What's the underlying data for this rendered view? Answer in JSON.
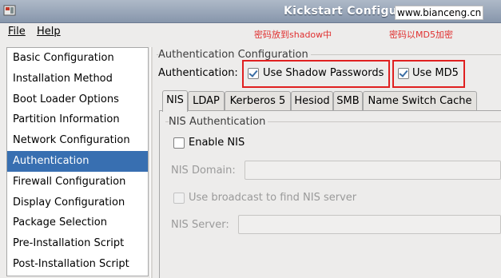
{
  "window": {
    "title": "Kickstart Configurator"
  },
  "watermark": "www.bianceng.cn",
  "menu": {
    "file_label": "File",
    "help_label": "Help"
  },
  "annotations": {
    "shadow_note": "密码放到shadow中",
    "md5_note": "密码以MD5加密"
  },
  "sidebar": {
    "items": [
      {
        "label": "Basic Configuration"
      },
      {
        "label": "Installation Method"
      },
      {
        "label": "Boot Loader Options"
      },
      {
        "label": "Partition Information"
      },
      {
        "label": "Network Configuration"
      },
      {
        "label": "Authentication"
      },
      {
        "label": "Firewall Configuration"
      },
      {
        "label": "Display Configuration"
      },
      {
        "label": "Package Selection"
      },
      {
        "label": "Pre-Installation Script"
      },
      {
        "label": "Post-Installation Script"
      }
    ],
    "selected": "Authentication"
  },
  "auth": {
    "group_title": "Authentication Configuration",
    "label": "Authentication:",
    "shadow": {
      "label": "Use Shadow Passwords",
      "checked": true
    },
    "md5": {
      "label": "Use MD5",
      "checked": true
    }
  },
  "tabs": [
    {
      "label": "NIS",
      "active": true
    },
    {
      "label": "LDAP"
    },
    {
      "label": "Kerberos 5"
    },
    {
      "label": "Hesiod"
    },
    {
      "label": "SMB"
    },
    {
      "label": "Name Switch Cache"
    }
  ],
  "nis": {
    "group_title": "NIS Authentication",
    "enable": {
      "label": "Enable NIS",
      "checked": false
    },
    "domain": {
      "label": "NIS Domain:",
      "value": ""
    },
    "broadcast": {
      "label": "Use broadcast to find NIS server",
      "checked": false
    },
    "server": {
      "label": "NIS Server:",
      "value": ""
    }
  }
}
